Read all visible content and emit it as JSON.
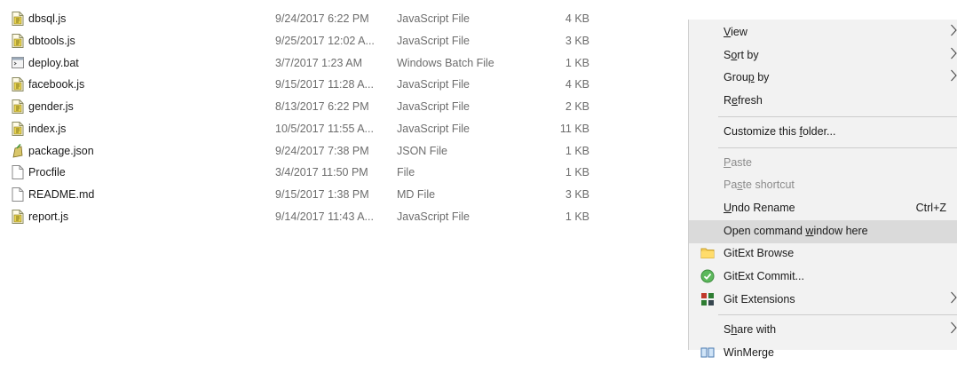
{
  "files": [
    {
      "name": "dbsql.js",
      "date": "9/24/2017 6:22 PM",
      "type": "JavaScript File",
      "size": "4 KB",
      "icon": "javascript-file-icon"
    },
    {
      "name": "dbtools.js",
      "date": "9/25/2017 12:02 A...",
      "type": "JavaScript File",
      "size": "3 KB",
      "icon": "javascript-file-icon"
    },
    {
      "name": "deploy.bat",
      "date": "3/7/2017 1:23 AM",
      "type": "Windows Batch File",
      "size": "1 KB",
      "icon": "batch-file-icon"
    },
    {
      "name": "facebook.js",
      "date": "9/15/2017 11:28 A...",
      "type": "JavaScript File",
      "size": "4 KB",
      "icon": "javascript-file-icon"
    },
    {
      "name": "gender.js",
      "date": "8/13/2017 6:22 PM",
      "type": "JavaScript File",
      "size": "2 KB",
      "icon": "javascript-file-icon"
    },
    {
      "name": "index.js",
      "date": "10/5/2017 11:55 A...",
      "type": "JavaScript File",
      "size": "11 KB",
      "icon": "javascript-file-icon"
    },
    {
      "name": "package.json",
      "date": "9/24/2017 7:38 PM",
      "type": "JSON File",
      "size": "1 KB",
      "icon": "json-file-icon"
    },
    {
      "name": "Procfile",
      "date": "3/4/2017 11:50 PM",
      "type": "File",
      "size": "1 KB",
      "icon": "blank-file-icon"
    },
    {
      "name": "README.md",
      "date": "9/15/2017 1:38 PM",
      "type": "MD File",
      "size": "3 KB",
      "icon": "blank-file-icon"
    },
    {
      "name": "report.js",
      "date": "9/14/2017 11:43 A...",
      "type": "JavaScript File",
      "size": "1 KB",
      "icon": "javascript-file-icon"
    }
  ],
  "context_menu": {
    "items": [
      {
        "kind": "item",
        "label": "View",
        "accel": "V",
        "submenu": true
      },
      {
        "kind": "item",
        "label": "Sort by",
        "accel": "o",
        "submenu": true
      },
      {
        "kind": "item",
        "label": "Group by",
        "accel": "p",
        "submenu": true
      },
      {
        "kind": "item",
        "label": "Refresh",
        "accel": "e"
      },
      {
        "kind": "separator"
      },
      {
        "kind": "item",
        "label": "Customize this folder...",
        "accel": "f"
      },
      {
        "kind": "separator"
      },
      {
        "kind": "item",
        "label": "Paste",
        "accel": "P",
        "disabled": true
      },
      {
        "kind": "item",
        "label": "Paste shortcut",
        "accel": "s",
        "disabled": true
      },
      {
        "kind": "item",
        "label": "Undo Rename",
        "accel": "U",
        "shortcut": "Ctrl+Z"
      },
      {
        "kind": "item",
        "label": "Open command window here",
        "accel": "w",
        "highlighted": true
      },
      {
        "kind": "item",
        "label": "GitExt Browse",
        "icon": "folder-icon"
      },
      {
        "kind": "item",
        "label": "GitExt Commit...",
        "icon": "commit-check-icon"
      },
      {
        "kind": "item",
        "label": "Git Extensions",
        "icon": "git-extensions-icon",
        "submenu": true
      },
      {
        "kind": "separator"
      },
      {
        "kind": "item",
        "label": "Share with",
        "accel": "h",
        "submenu": true
      },
      {
        "kind": "item",
        "label": "WinMerge",
        "icon": "winmerge-icon"
      }
    ]
  },
  "colors": {
    "menu_bg": "#f2f2f2",
    "menu_highlight": "#dadada",
    "disabled_text": "#8c8c8c",
    "secondary_text": "#6d6d6d"
  }
}
